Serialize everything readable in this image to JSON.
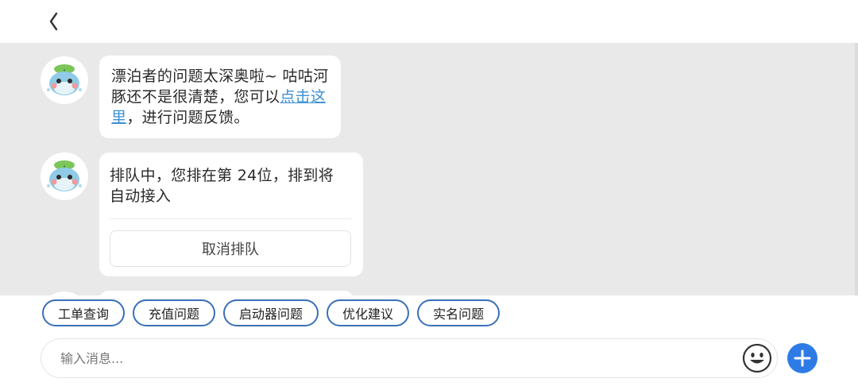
{
  "header": {
    "back_icon": "chevron-left-icon"
  },
  "messages": [
    {
      "type": "text",
      "avatar": "bot-avatar",
      "text_before_link": "漂泊者的问题太深奥啦~ 咕咕河豚还不是很清楚，您可以",
      "link_text": "点击这里",
      "text_after_link": "，进行问题反馈。"
    },
    {
      "type": "queue",
      "avatar": "bot-avatar",
      "text": "排队中，您排在第 24位，排到将自动接入",
      "button_label": "取消排队"
    }
  ],
  "quick_replies": [
    "工单查询",
    "充值问题",
    "启动器问题",
    "优化建议",
    "实名问题"
  ],
  "composer": {
    "placeholder": "输入消息...",
    "emoji_icon": "emoji-icon",
    "plus_icon": "plus-icon"
  },
  "colors": {
    "chat_background": "#e9e9e9",
    "link": "#3c8fd6",
    "chip_border": "#3a6fb8",
    "plus_button": "#2f7be6"
  }
}
